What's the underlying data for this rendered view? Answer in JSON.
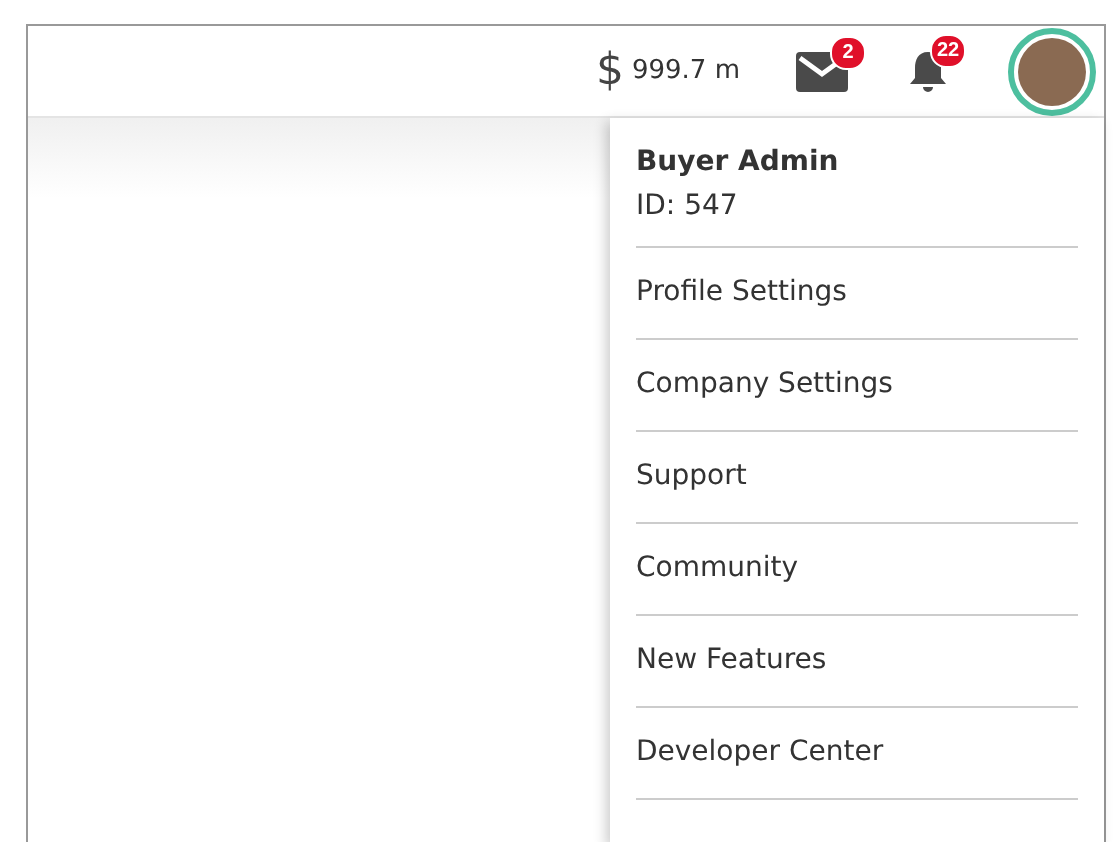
{
  "header": {
    "currency_symbol": "$",
    "balance": "999.7 m",
    "messages_badge": "2",
    "notifications_badge": "22"
  },
  "menu": {
    "user_name": "Buyer Admin",
    "user_id": "ID: 547",
    "items": [
      "Profile Settings",
      "Company Settings",
      "Support",
      "Community",
      "New Features",
      "Developer Center"
    ]
  }
}
